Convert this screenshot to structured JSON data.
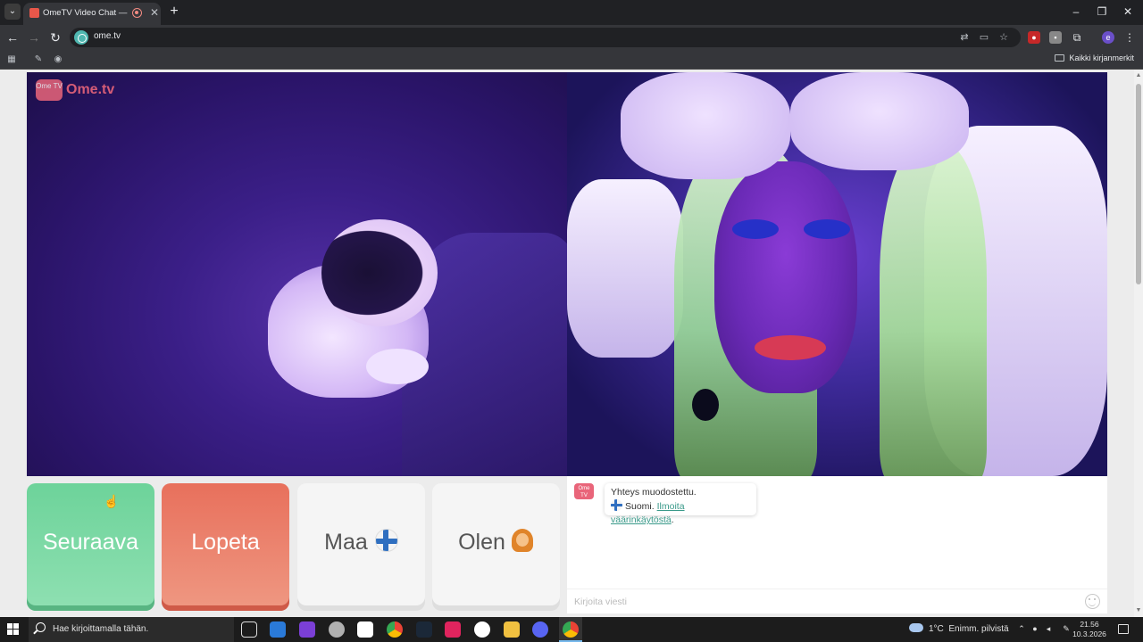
{
  "browser": {
    "tab_title": "OmeTV Video Chat — Ome",
    "tab_close": "✕",
    "new_tab": "+",
    "url": "ome.tv",
    "window_controls": {
      "minimize": "–",
      "maximize": "❐",
      "close": "✕"
    },
    "bookmarks_all": "Kaikki kirjanmerkit",
    "profile_initial": "e"
  },
  "logo": {
    "badge": "Ome TV",
    "text": "Ome.tv"
  },
  "controls": {
    "next_label": "Seuraava",
    "stop_label": "Lopeta",
    "country_label": "Maa",
    "gender_label": "Olen"
  },
  "chat": {
    "logo_badge": "Ome TV",
    "connected": "Yhteys muodostettu.",
    "country": "Suomi.",
    "report_link": "Ilmoita väärinkäytöstä",
    "report_suffix": ".",
    "input_placeholder": "Kirjoita viesti"
  },
  "taskbar": {
    "search_placeholder": "Hae kirjoittamalla tähän.",
    "temperature": "1°C",
    "weather_desc": "Enimm. pilvistä",
    "time": "21.56",
    "date": "10.3.2026"
  },
  "colors": {
    "next_green": "#6dd39a",
    "stop_red": "#e8705c",
    "link_teal": "#3a9a8a",
    "brand_pink": "#e9657a"
  }
}
